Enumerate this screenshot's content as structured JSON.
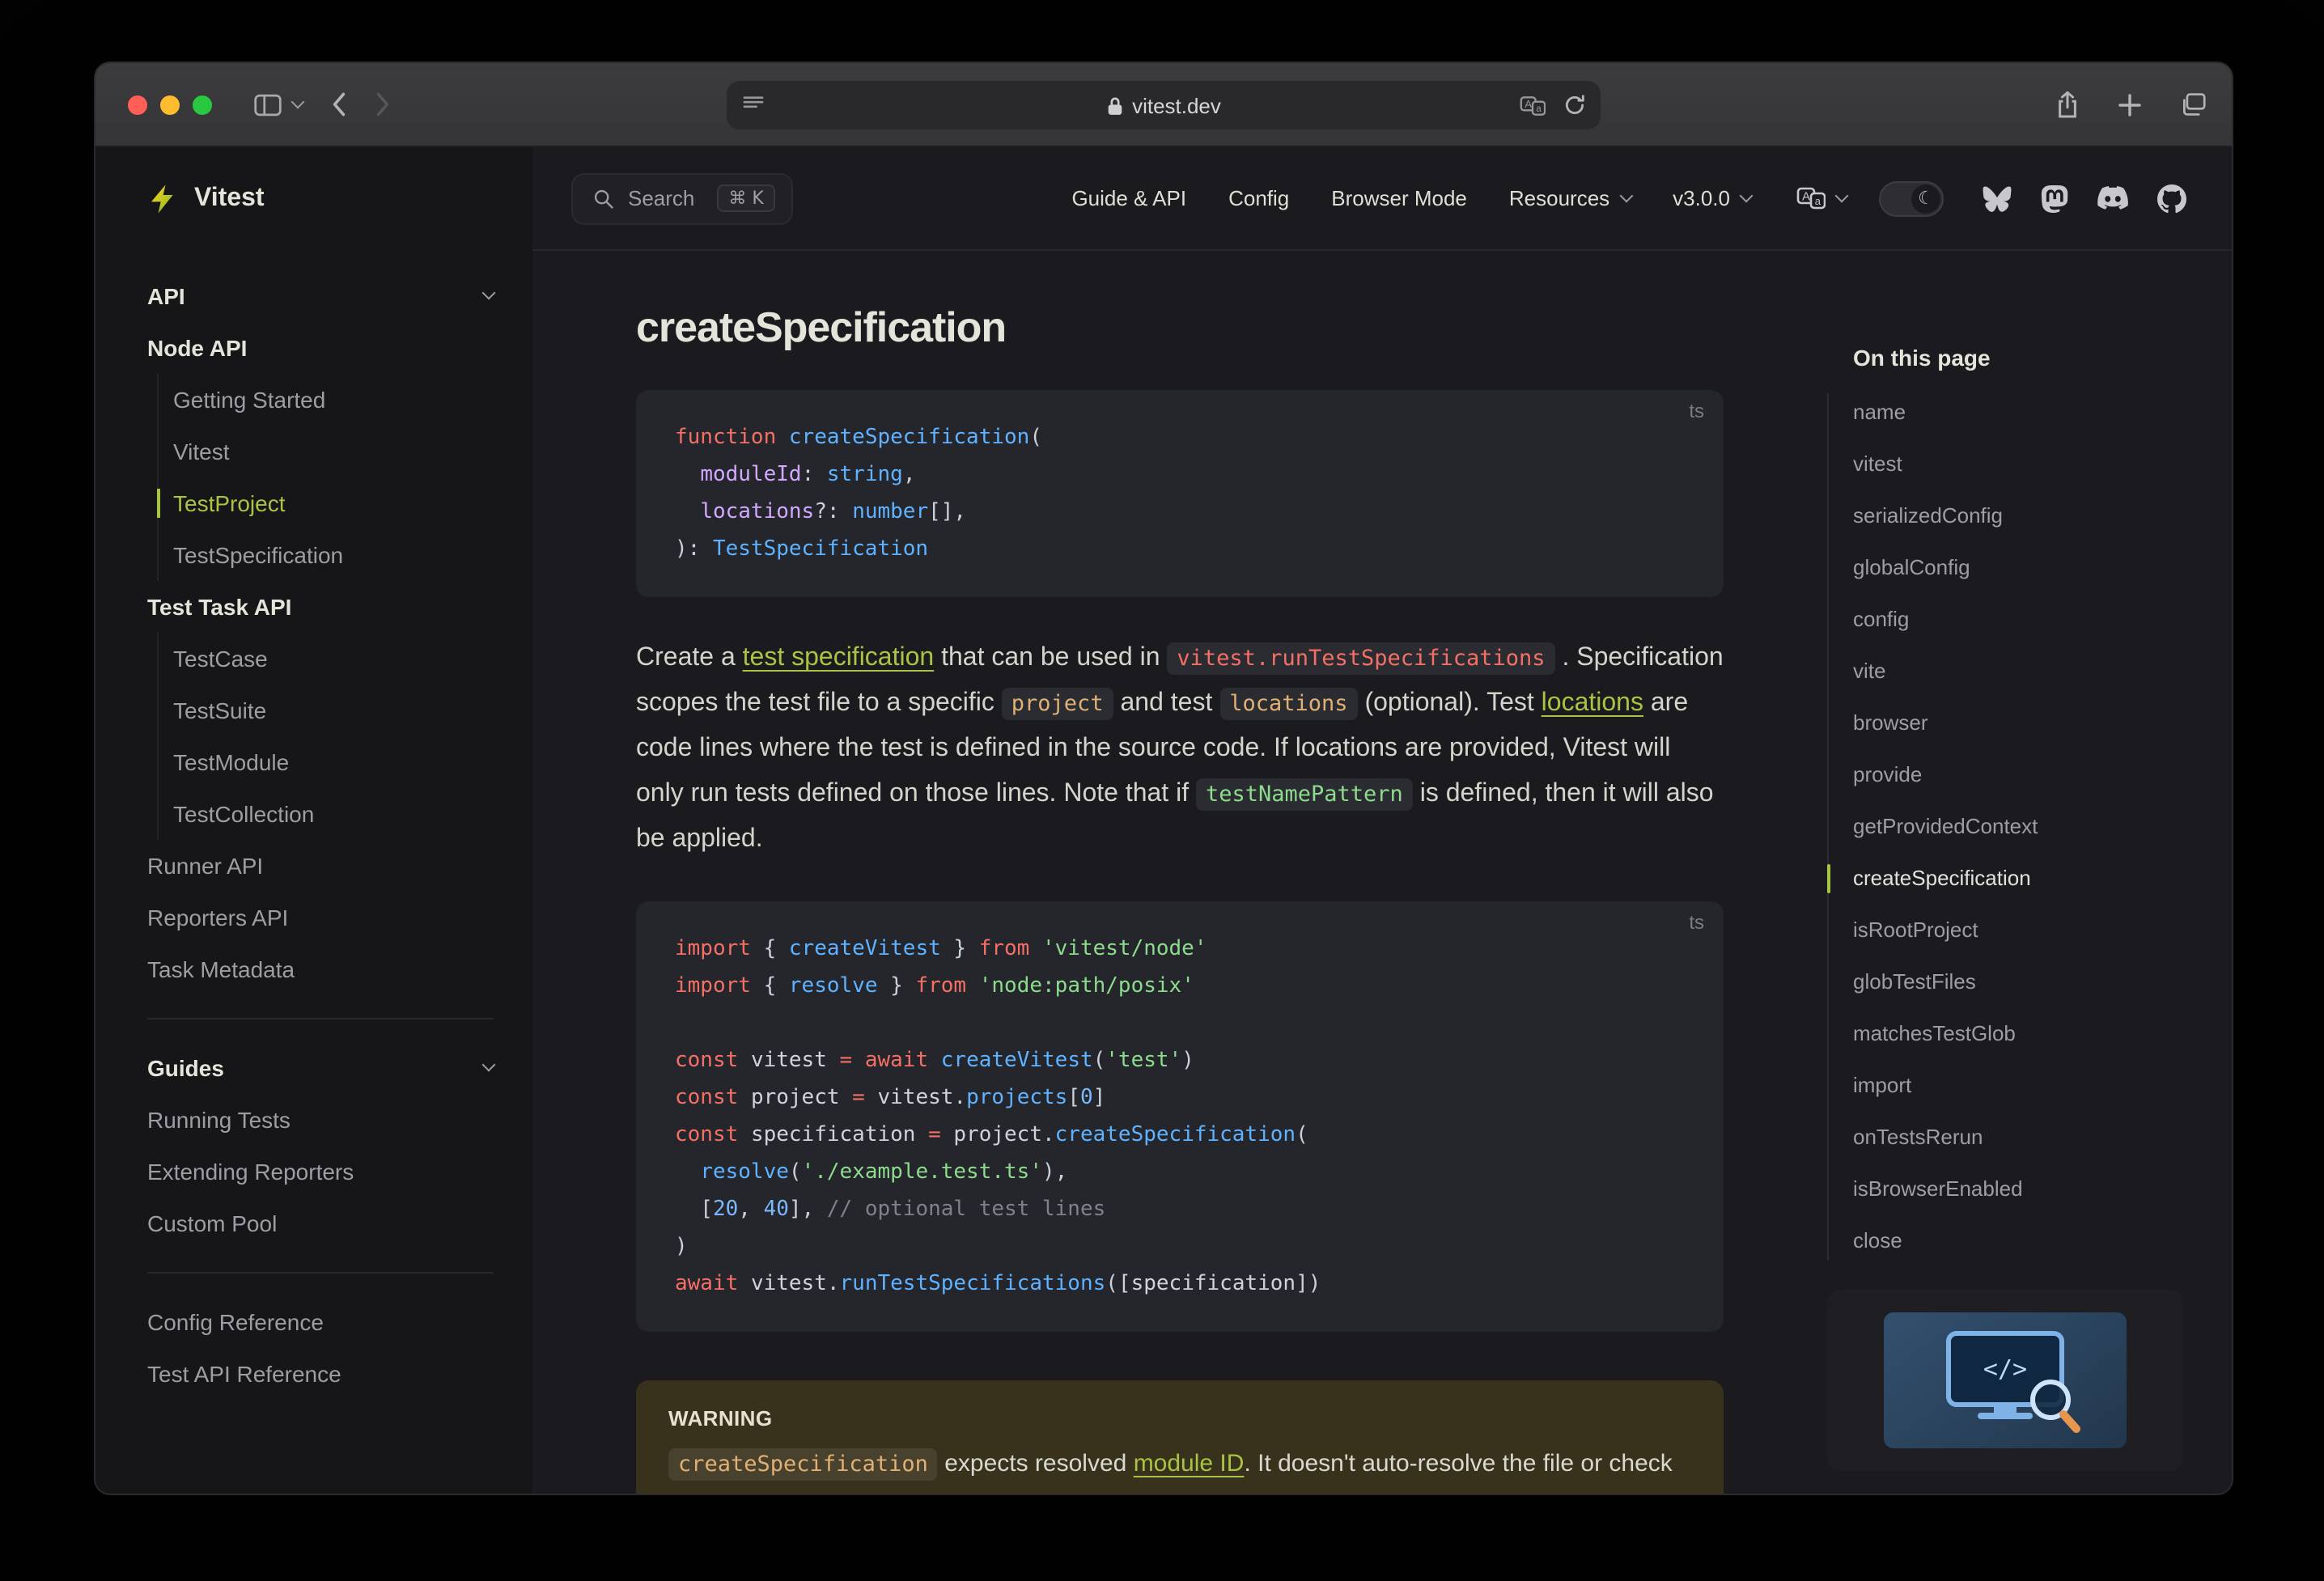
{
  "theme": {
    "accent": "#a9c344",
    "page_bg": "#1b1b1f",
    "sidebar_bg": "#161618",
    "code_bg": "#25262b",
    "warning_bg": "#38311c"
  },
  "code_theme": {
    "kw": "#f47067",
    "op": "#f47067",
    "fn": "#5fb2ff",
    "prp": "#5fb2ff",
    "typ": "#5fb2ff",
    "prm": "#d2a8ff",
    "str": "#8ddb8c",
    "num": "#79b8ff",
    "cm": "#7d828b",
    "pn": "#c9d1d9",
    "var": "#ced4db"
  },
  "browser": {
    "url": "vitest.dev",
    "traffic_lights": [
      "#ff5f57",
      "#febc2e",
      "#28c840"
    ]
  },
  "navbar": {
    "search": {
      "label": "Search",
      "shortcut": "⌘ K"
    },
    "links": [
      {
        "label": "Guide & API"
      },
      {
        "label": "Config"
      },
      {
        "label": "Browser Mode"
      },
      {
        "label": "Resources",
        "dropdown": true
      },
      {
        "label": "v3.0.0",
        "dropdown": true
      }
    ]
  },
  "sidebar": {
    "logo_text": "Vitest",
    "items": [
      {
        "kind": "section",
        "label": "API"
      },
      {
        "kind": "subsection",
        "label": "Node API"
      },
      {
        "kind": "nested",
        "label": "Getting Started"
      },
      {
        "kind": "nested",
        "label": "Vitest"
      },
      {
        "kind": "nested",
        "label": "TestProject",
        "active": true
      },
      {
        "kind": "nested",
        "label": "TestSpecification"
      },
      {
        "kind": "subsection",
        "label": "Test Task API"
      },
      {
        "kind": "nested",
        "label": "TestCase"
      },
      {
        "kind": "nested",
        "label": "TestSuite"
      },
      {
        "kind": "nested",
        "label": "TestModule"
      },
      {
        "kind": "nested",
        "label": "TestCollection"
      },
      {
        "kind": "item",
        "label": "Runner API"
      },
      {
        "kind": "item",
        "label": "Reporters API"
      },
      {
        "kind": "item",
        "label": "Task Metadata"
      },
      {
        "kind": "divider"
      },
      {
        "kind": "section",
        "label": "Guides"
      },
      {
        "kind": "item",
        "label": "Running Tests"
      },
      {
        "kind": "item",
        "label": "Extending Reporters"
      },
      {
        "kind": "item",
        "label": "Custom Pool"
      },
      {
        "kind": "divider"
      },
      {
        "kind": "item",
        "label": "Config Reference"
      },
      {
        "kind": "item",
        "label": "Test API Reference"
      }
    ]
  },
  "page": {
    "title": "createSpecification",
    "code_block_1": {
      "lang": "ts",
      "lines": [
        [
          [
            "kw",
            "function "
          ],
          [
            "fn",
            "createSpecification"
          ],
          [
            "pn",
            "("
          ]
        ],
        [
          [
            "pn",
            "  "
          ],
          [
            "prm",
            "moduleId"
          ],
          [
            "pn",
            ": "
          ],
          [
            "typ",
            "string"
          ],
          [
            "pn",
            ","
          ]
        ],
        [
          [
            "pn",
            "  "
          ],
          [
            "prm",
            "locations"
          ],
          [
            "pn",
            "?: "
          ],
          [
            "typ",
            "number"
          ],
          [
            "pn",
            "[],"
          ]
        ],
        [
          [
            "pn",
            "): "
          ],
          [
            "typ",
            "TestSpecification"
          ]
        ]
      ]
    },
    "paragraph": [
      {
        "type": "text",
        "text": "Create a "
      },
      {
        "type": "link",
        "text": "test specification"
      },
      {
        "type": "text",
        "text": " that can be used in "
      },
      {
        "type": "code",
        "text": "vitest.runTestSpecifications",
        "color": "#f47067"
      },
      {
        "type": "text",
        "text": " . Specification scopes the test file to a specific "
      },
      {
        "type": "code",
        "text": "project",
        "color": "#e0b074"
      },
      {
        "type": "text",
        "text": " and test "
      },
      {
        "type": "code",
        "text": "locations",
        "color": "#e0b074"
      },
      {
        "type": "text",
        "text": " (optional). Test "
      },
      {
        "type": "link",
        "text": "locations"
      },
      {
        "type": "text",
        "text": " are code lines where the test is defined in the source code. If locations are provided, Vitest will only run tests defined on those lines. Note that if "
      },
      {
        "type": "code",
        "text": "testNamePattern",
        "color": "#8ddb8c"
      },
      {
        "type": "text",
        "text": " is defined, then it will also be applied."
      }
    ],
    "code_block_2": {
      "lang": "ts",
      "lines": [
        [
          [
            "kw",
            "import"
          ],
          [
            "pn",
            " { "
          ],
          [
            "fn",
            "createVitest"
          ],
          [
            "pn",
            " } "
          ],
          [
            "kw",
            "from"
          ],
          [
            "pn",
            " "
          ],
          [
            "str",
            "'vitest/node'"
          ]
        ],
        [
          [
            "kw",
            "import"
          ],
          [
            "pn",
            " { "
          ],
          [
            "fn",
            "resolve"
          ],
          [
            "pn",
            " } "
          ],
          [
            "kw",
            "from"
          ],
          [
            "pn",
            " "
          ],
          [
            "str",
            "'node:path/posix'"
          ]
        ],
        [],
        [
          [
            "kw",
            "const"
          ],
          [
            "pn",
            " "
          ],
          [
            "var",
            "vitest"
          ],
          [
            "op",
            " = "
          ],
          [
            "kw",
            "await"
          ],
          [
            "pn",
            " "
          ],
          [
            "fn",
            "createVitest"
          ],
          [
            "pn",
            "("
          ],
          [
            "str",
            "'test'"
          ],
          [
            "pn",
            ")"
          ]
        ],
        [
          [
            "kw",
            "const"
          ],
          [
            "pn",
            " "
          ],
          [
            "var",
            "project"
          ],
          [
            "op",
            " = "
          ],
          [
            "var",
            "vitest"
          ],
          [
            "pn",
            "."
          ],
          [
            "prp",
            "projects"
          ],
          [
            "pn",
            "["
          ],
          [
            "num",
            "0"
          ],
          [
            "pn",
            "]"
          ]
        ],
        [
          [
            "kw",
            "const"
          ],
          [
            "pn",
            " "
          ],
          [
            "var",
            "specification"
          ],
          [
            "op",
            " = "
          ],
          [
            "var",
            "project"
          ],
          [
            "pn",
            "."
          ],
          [
            "fn",
            "createSpecification"
          ],
          [
            "pn",
            "("
          ]
        ],
        [
          [
            "pn",
            "  "
          ],
          [
            "fn",
            "resolve"
          ],
          [
            "pn",
            "("
          ],
          [
            "str",
            "'./example.test.ts'"
          ],
          [
            "pn",
            "),"
          ]
        ],
        [
          [
            "pn",
            "  ["
          ],
          [
            "num",
            "20"
          ],
          [
            "pn",
            ", "
          ],
          [
            "num",
            "40"
          ],
          [
            "pn",
            "], "
          ],
          [
            "cm",
            "// optional test lines"
          ]
        ],
        [
          [
            "pn",
            ")"
          ]
        ],
        [
          [
            "kw",
            "await"
          ],
          [
            "pn",
            " "
          ],
          [
            "var",
            "vitest"
          ],
          [
            "pn",
            "."
          ],
          [
            "fn",
            "runTestSpecifications"
          ],
          [
            "pn",
            "(["
          ],
          [
            "var",
            "specification"
          ],
          [
            "pn",
            "])"
          ]
        ]
      ]
    },
    "warning": {
      "title": "WARNING",
      "body": [
        {
          "type": "code",
          "text": "createSpecification",
          "color": "#e0b074"
        },
        {
          "type": "text",
          "text": " expects resolved "
        },
        {
          "type": "link",
          "text": "module ID"
        },
        {
          "type": "text",
          "text": ". It doesn't auto-resolve the file or check that it exists on the file system."
        }
      ]
    }
  },
  "toc": {
    "title": "On this page",
    "items": [
      "name",
      "vitest",
      "serializedConfig",
      "globalConfig",
      "config",
      "vite",
      "browser",
      "provide",
      "getProvidedContext",
      "createSpecification",
      "isRootProject",
      "globTestFiles",
      "matchesTestGlob",
      "import",
      "onTestsRerun",
      "isBrowserEnabled",
      "close"
    ],
    "active": "createSpecification"
  }
}
